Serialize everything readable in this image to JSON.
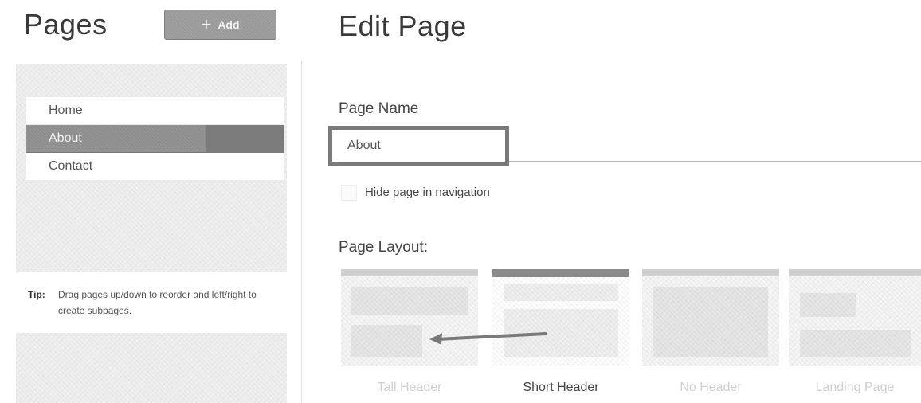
{
  "sidebar": {
    "title": "Pages",
    "add_button": {
      "icon": "plus-icon",
      "label": "Add"
    },
    "pages": [
      {
        "label": "Home",
        "active": false
      },
      {
        "label": "About",
        "active": true
      },
      {
        "label": "Contact",
        "active": false
      }
    ],
    "tip": {
      "label": "Tip:",
      "text": "Drag pages up/down to reorder and left/right to create subpages."
    }
  },
  "editor": {
    "title": "Edit Page",
    "page_name_label": "Page Name",
    "page_name_value": "About",
    "hide_in_nav_label": "Hide page in navigation",
    "hide_in_nav_checked": false,
    "layout_label": "Page Layout:",
    "layouts": [
      {
        "label": "Tall Header",
        "selected": false
      },
      {
        "label": "Short Header",
        "selected": true
      },
      {
        "label": "No Header",
        "selected": false
      },
      {
        "label": "Landing Page",
        "selected": false
      }
    ]
  },
  "colors": {
    "selected_accent": "#8a8a8a",
    "active_item": "#8e8e8e",
    "text": "#444444"
  }
}
